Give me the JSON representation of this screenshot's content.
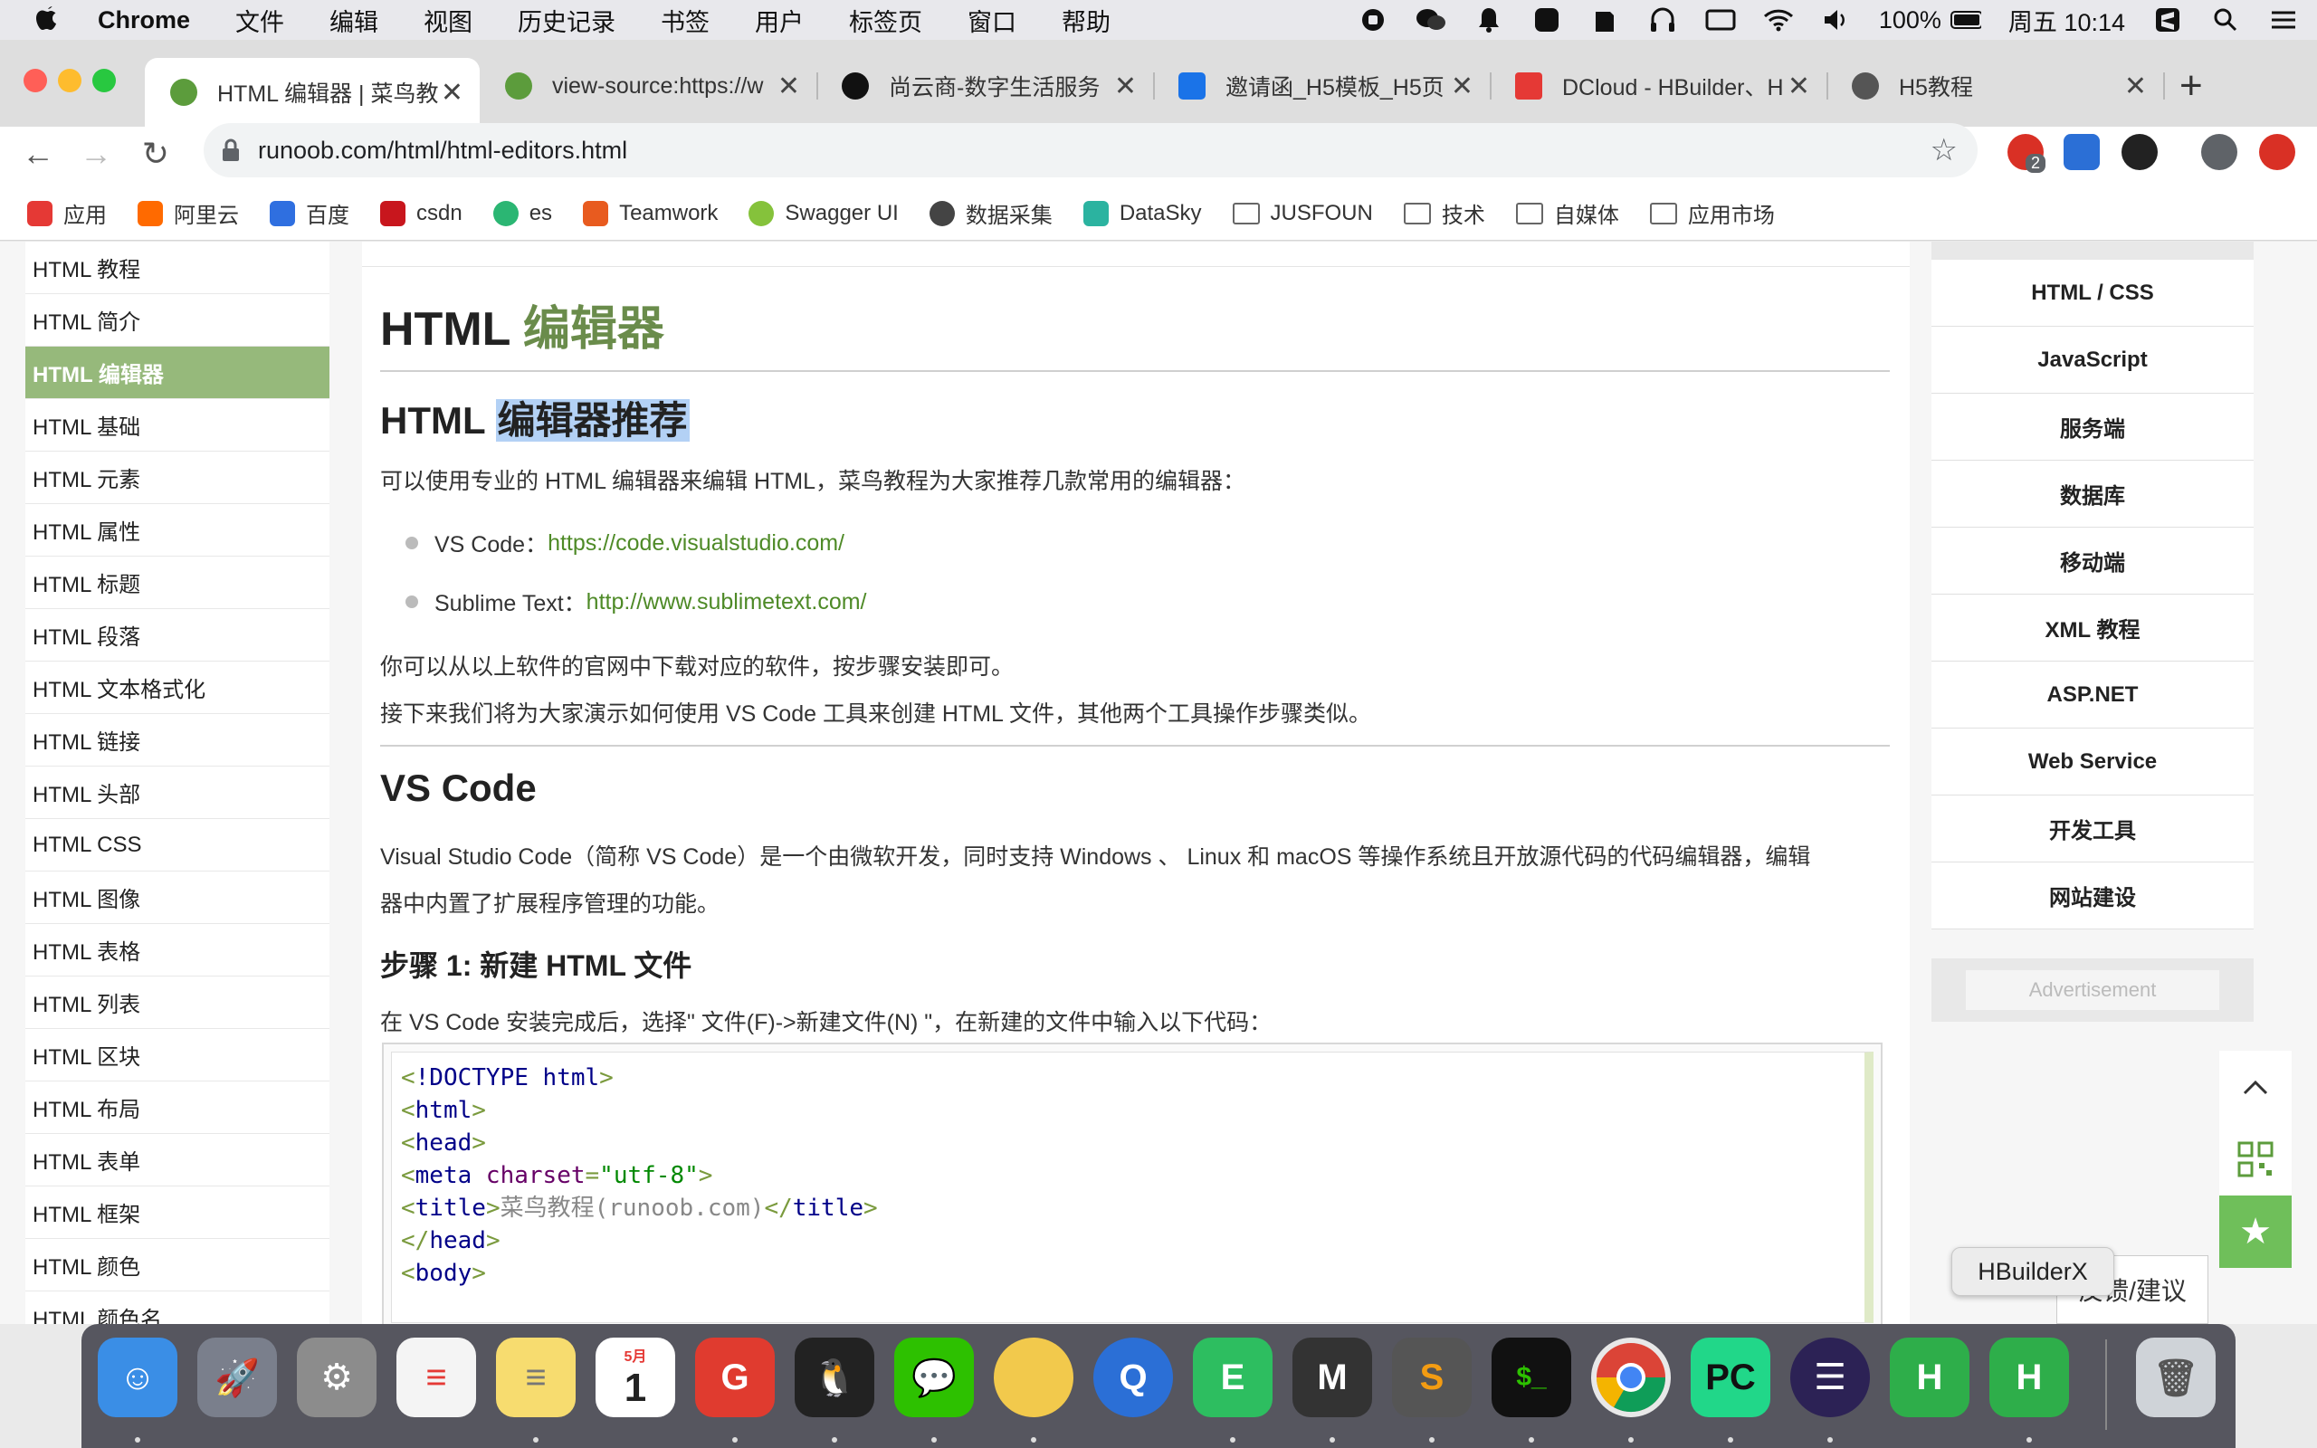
{
  "menubar": {
    "app": "Chrome",
    "items": [
      "文件",
      "编辑",
      "视图",
      "历史记录",
      "书签",
      "用户",
      "标签页",
      "窗口",
      "帮助"
    ],
    "battery": "100%",
    "clock": "周五 10:14"
  },
  "tabs": [
    {
      "title": "HTML 编辑器 | 菜鸟教",
      "color": "#5c9c3c"
    },
    {
      "title": "view-source:https://w",
      "color": "#5c9c3c"
    },
    {
      "title": "尚云商-数字生活服务",
      "color": "#111111"
    },
    {
      "title": "邀请函_H5模板_H5页",
      "color": "#1a73e8"
    },
    {
      "title": "DCloud - HBuilder、H",
      "color": "#e53935"
    },
    {
      "title": "H5教程",
      "color": "#555555"
    }
  ],
  "address": {
    "url": "runoob.com/html/html-editors.html"
  },
  "extensions": {
    "badge": "2"
  },
  "bookmarks": [
    {
      "label": "应用",
      "color": "#e53935"
    },
    {
      "label": "阿里云",
      "color": "#ff6a00"
    },
    {
      "label": "百度",
      "color": "#2f6fe0"
    },
    {
      "label": "csdn",
      "color": "#c8161d"
    },
    {
      "label": "es",
      "color": "#2bb673"
    },
    {
      "label": "Teamwork",
      "color": "#e85b1f"
    },
    {
      "label": "Swagger UI",
      "color": "#85c23b"
    },
    {
      "label": "数据采集",
      "color": "#444444"
    },
    {
      "label": "DataSky",
      "color": "#2bb3a0"
    },
    {
      "label": "JUSFOUN",
      "folder": true
    },
    {
      "label": "技术",
      "folder": true
    },
    {
      "label": "自媒体",
      "folder": true
    },
    {
      "label": "应用市场",
      "folder": true
    }
  ],
  "sidebar": {
    "items": [
      "HTML 教程",
      "HTML 简介",
      "HTML 编辑器",
      "HTML 基础",
      "HTML 元素",
      "HTML 属性",
      "HTML 标题",
      "HTML 段落",
      "HTML 文本格式化",
      "HTML 链接",
      "HTML 头部",
      "HTML CSS",
      "HTML 图像",
      "HTML 表格",
      "HTML 列表",
      "HTML 区块",
      "HTML 布局",
      "HTML 表单",
      "HTML 框架",
      "HTML 颜色",
      "HTML 颜色名"
    ],
    "active_index": 2
  },
  "article": {
    "title_a": "HTML",
    "title_b": "编辑器",
    "h2_a": "HTML",
    "h2_b": "编辑器推荐",
    "intro": "可以使用专业的 HTML 编辑器来编辑 HTML，菜鸟教程为大家推荐几款常用的编辑器：",
    "list": [
      {
        "label": "VS Code：",
        "link": "https://code.visualstudio.com/"
      },
      {
        "label": "Sublime Text：",
        "link": "http://www.sublimetext.com/"
      }
    ],
    "p1": "你可以从以上软件的官网中下载对应的软件，按步骤安装即可。",
    "p2": "接下来我们将为大家演示如何使用 VS Code 工具来创建 HTML 文件，其他两个工具操作步骤类似。",
    "vs_title": "VS Code",
    "vs_desc_1": "Visual Studio Code（简称 VS Code）是一个由微软开发，同时支持 Windows 、 Linux 和 macOS 等操作系统且开放源代码的代码编辑器，编辑",
    "vs_desc_2": "器中内置了扩展程序管理的功能。",
    "step1": "步骤 1: 新建 HTML 文件",
    "step1_desc": "在 VS Code 安装完成后，选择\" 文件(F)->新建文件(N) \"，在新建的文件中输入以下代码："
  },
  "code": [
    {
      "p1": "<",
      "t": "!DOCTYPE html",
      "p2": ">"
    },
    {
      "p1": "<",
      "t": "html",
      "p2": ">"
    },
    {
      "p1": "<",
      "t": "head",
      "p2": ">"
    },
    {
      "p1": "<",
      "t": "meta",
      "a": " charset",
      "eq": "=",
      "s": "\"utf-8\"",
      "p2": ">"
    },
    {
      "p1": "<",
      "t": "title",
      "p2": ">",
      "x": "菜鸟教程(runoob.com)",
      "p3": "</",
      "t2": "title",
      "p4": ">"
    },
    {
      "p1": "</",
      "t": "head",
      "p2": ">"
    },
    {
      "p1": "<",
      "t": "body",
      "p2": ">"
    }
  ],
  "right_nav": [
    "HTML / CSS",
    "JavaScript",
    "服务端",
    "数据库",
    "移动端",
    "XML 教程",
    "ASP.NET",
    "Web Service",
    "开发工具",
    "网站建设"
  ],
  "ad": "Advertisement",
  "feedback": "反馈/建议",
  "tooltip": "HBuilderX",
  "dock": [
    {
      "name": "finder",
      "color": "#3a8ee6",
      "glyph": "☺"
    },
    {
      "name": "launchpad",
      "color": "#7a7f8c",
      "glyph": "🚀"
    },
    {
      "name": "system-preferences",
      "color": "#8c8c8c",
      "glyph": "⚙"
    },
    {
      "name": "reminders",
      "color": "#f4f4f4",
      "glyph": "≡"
    },
    {
      "name": "notes",
      "color": "#f7dc6f",
      "glyph": "≡"
    },
    {
      "name": "calendar",
      "color": "#ffffff",
      "glyph": "1",
      "month": "5月"
    },
    {
      "name": "git-tool",
      "color": "#e03b2f",
      "glyph": "G"
    },
    {
      "name": "qq",
      "color": "#222222",
      "glyph": "🐧"
    },
    {
      "name": "wechat",
      "color": "#2dc100",
      "glyph": "💬"
    },
    {
      "name": "app-yellow",
      "color": "#f2c94c",
      "glyph": "●"
    },
    {
      "name": "quicktime",
      "color": "#2b6fd6",
      "glyph": "Q"
    },
    {
      "name": "evernote",
      "color": "#2dbe60",
      "glyph": "E"
    },
    {
      "name": "terminal-tool",
      "color": "#333333",
      "glyph": "M"
    },
    {
      "name": "sublime-text",
      "color": "#555555",
      "glyph": "S"
    },
    {
      "name": "terminal",
      "color": "#111111",
      "glyph": "$"
    },
    {
      "name": "chrome",
      "color": "#e8e8e8",
      "glyph": "◉"
    },
    {
      "name": "pycharm",
      "color": "#21d789",
      "glyph": "PC"
    },
    {
      "name": "eclipse",
      "color": "#2c2255",
      "glyph": "☰"
    },
    {
      "name": "hbuilder",
      "color": "#2eae4a",
      "glyph": "H"
    },
    {
      "name": "hbuilderx",
      "color": "#2eae4a",
      "glyph": "H"
    },
    {
      "name": "trash",
      "color": "#cfd3d8",
      "glyph": "🗑"
    }
  ]
}
